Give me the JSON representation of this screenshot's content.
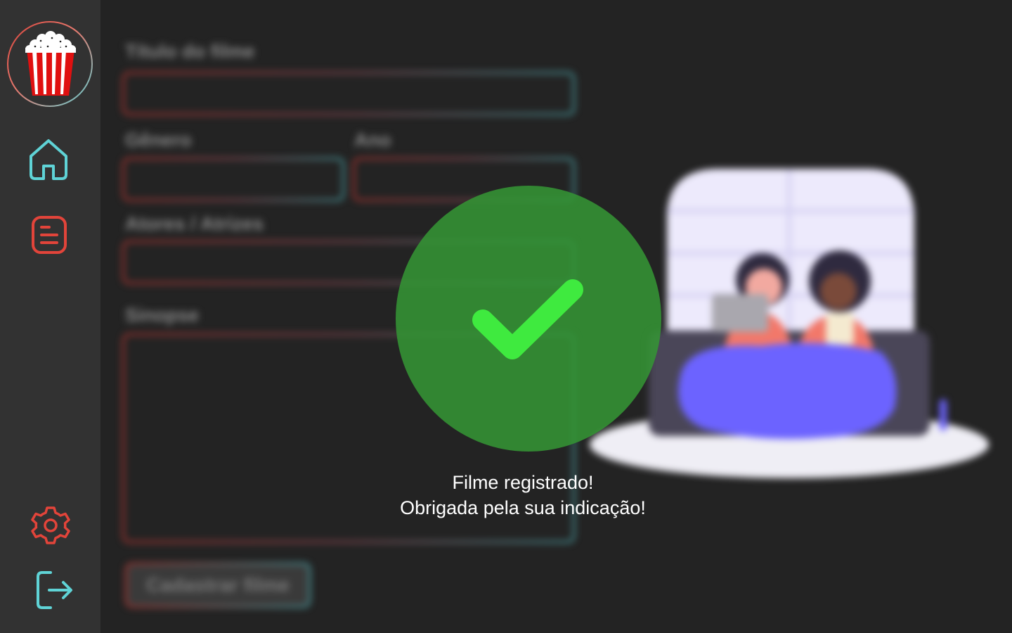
{
  "sidebar": {
    "logo": "popcorn-logo",
    "items": [
      {
        "icon": "home-icon",
        "color": "#5fd3d6"
      },
      {
        "icon": "list-icon",
        "color": "#e2443a"
      },
      {
        "icon": "gear-icon",
        "color": "#e2443a"
      },
      {
        "icon": "logout-icon",
        "color": "#5fd3d6"
      }
    ]
  },
  "form": {
    "title_label": "Título do filme",
    "genre_label": "Gênero",
    "year_label": "Ano",
    "actors_label": "Atores / Atrizes",
    "synopsis_label": "Sinopse",
    "submit_label": "Cadastrar filme"
  },
  "success": {
    "line1": "Filme registrado!",
    "line2": "Obrigada pela sua indicação!",
    "color": "#3fea3f"
  }
}
